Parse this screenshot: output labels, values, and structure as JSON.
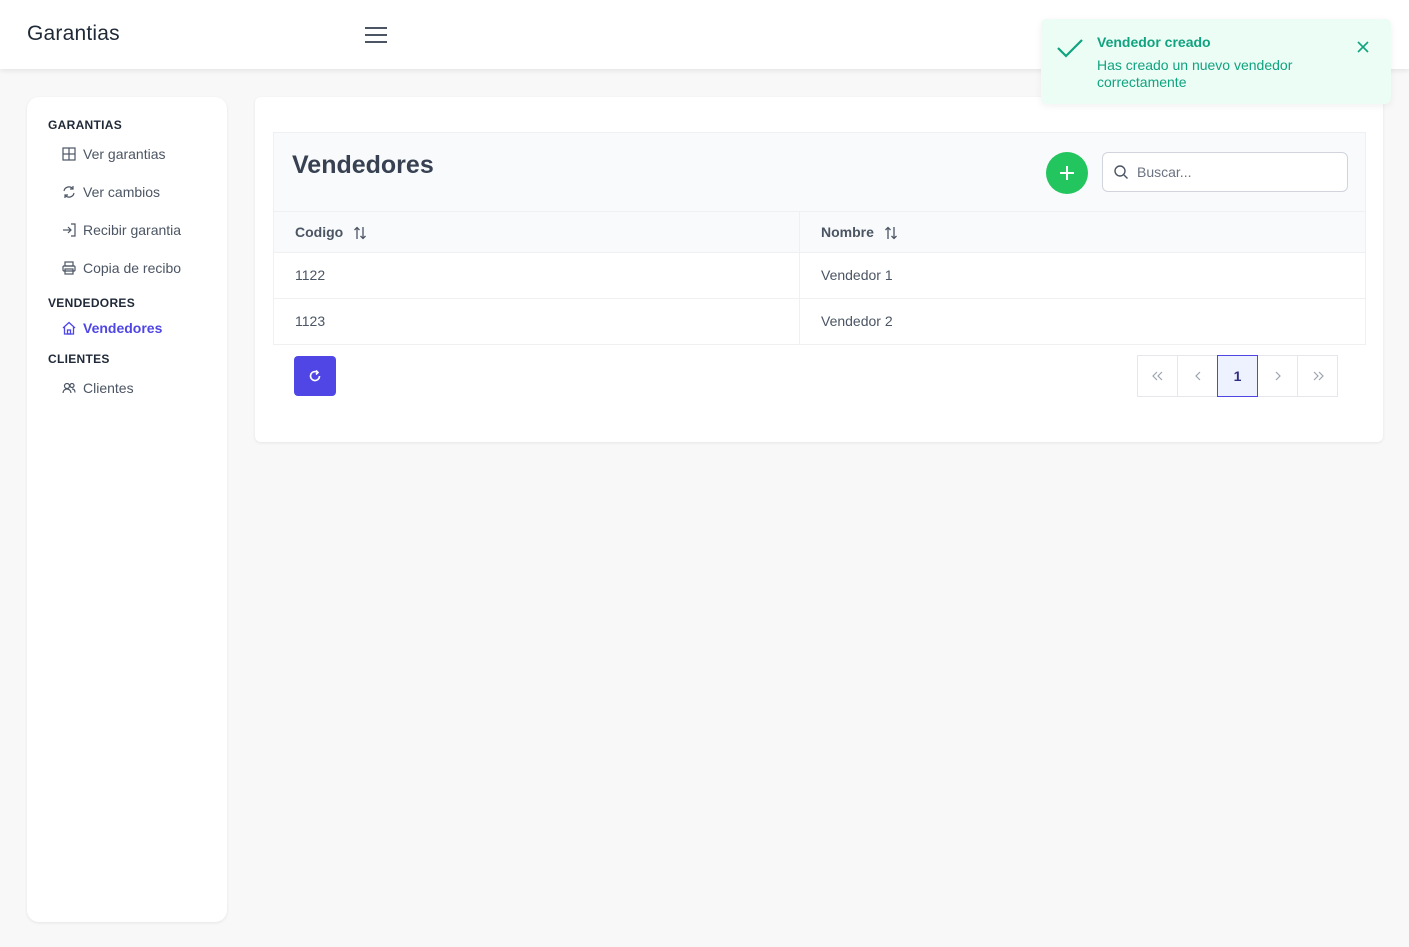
{
  "app": {
    "title": "Garantias"
  },
  "sidebar": {
    "sections": [
      {
        "title": "GARANTIAS",
        "items": [
          {
            "label": "Ver garantias",
            "icon": "table-icon"
          },
          {
            "label": "Ver cambios",
            "icon": "refresh-arrows-icon"
          },
          {
            "label": "Recibir garantia",
            "icon": "sign-in-icon"
          },
          {
            "label": "Copia de recibo",
            "icon": "print-icon"
          }
        ]
      },
      {
        "title": "VENDEDORES",
        "items": [
          {
            "label": "Vendedores",
            "icon": "home-icon",
            "active": true
          }
        ]
      },
      {
        "title": "CLIENTES",
        "items": [
          {
            "label": "Clientes",
            "icon": "users-icon"
          }
        ]
      }
    ]
  },
  "main": {
    "title": "Vendedores",
    "search": {
      "placeholder": "Buscar...",
      "value": ""
    },
    "columns": [
      "Codigo",
      "Nombre"
    ],
    "rows": [
      {
        "codigo": "1122",
        "nombre": "Vendedor 1"
      },
      {
        "codigo": "1123",
        "nombre": "Vendedor 2"
      }
    ],
    "pagination": {
      "current": "1"
    }
  },
  "toast": {
    "title": "Vendedor creado",
    "message": "Has creado un nuevo vendedor correctamente"
  },
  "colors": {
    "accent": "#4f46e5",
    "success": "#22c55e",
    "toast_text": "#10a37f",
    "toast_bg": "#ecfdf5"
  }
}
